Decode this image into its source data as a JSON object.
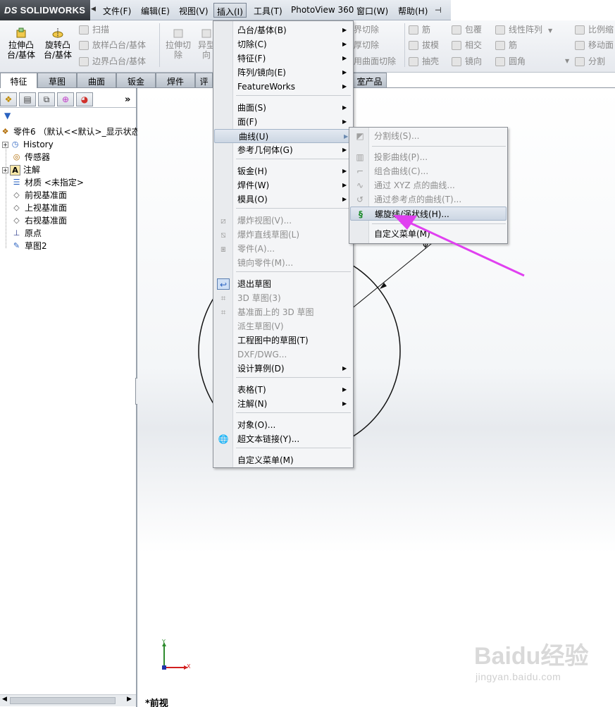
{
  "app": {
    "logo": "SOLIDWORKS",
    "logo_prefix": "DS"
  },
  "menubar": {
    "items": [
      "文件(F)",
      "编辑(E)",
      "视图(V)",
      "插入(I)",
      "工具(T)",
      "PhotoView 360",
      "窗口(W)",
      "帮助(H)"
    ],
    "active_index": 3
  },
  "ribbon": {
    "extrude_boss": "拉伸凸\n台/基体",
    "revolve_boss": "旋转凸\n台/基体",
    "sweep": "扫描",
    "loft": "放样凸台/基体",
    "boundary": "边界凸台/基体",
    "extrude_cut": "拉伸切\n除",
    "hole_wizard": "异型\n向",
    "boundary_cut": "界切除",
    "loft_cut": "厚切除",
    "surface_cut": "用曲面切除",
    "rib": "筋",
    "draft": "拔模",
    "shell": "抽壳",
    "wrap": "包覆",
    "intersect": "相交",
    "mirror": "镜向",
    "linear_pattern": "线性阵列",
    "rib2": "筋",
    "fillet": "圆角",
    "scale": "比例缩",
    "move_face": "移动面",
    "split": "分割"
  },
  "tabs": {
    "items": [
      "特征",
      "草图",
      "曲面",
      "钣金",
      "焊件",
      "评",
      "室产品"
    ],
    "selected_index": 0
  },
  "tree": {
    "root": "零件6 （默认<<默认>_显示状态",
    "items": [
      "History",
      "传感器",
      "注解",
      "材质 <未指定>",
      "前视基准面",
      "上视基准面",
      "右视基准面",
      "原点",
      "草图2"
    ]
  },
  "insert_menu": {
    "items": [
      {
        "label": "凸台/基体(B)",
        "sub": true
      },
      {
        "label": "切除(C)",
        "sub": true
      },
      {
        "label": "特征(F)",
        "sub": true
      },
      {
        "label": "阵列/镜向(E)",
        "sub": true
      },
      {
        "label": "FeatureWorks",
        "sub": true
      },
      {
        "label": "曲面(S)",
        "sub": true
      },
      {
        "label": "面(F)",
        "sub": true
      },
      {
        "label": "曲线(U)",
        "sub": true,
        "highlighted": true
      },
      {
        "label": "参考几何体(G)",
        "sub": true
      },
      {
        "label": "钣金(H)",
        "sub": true
      },
      {
        "label": "焊件(W)",
        "sub": true
      },
      {
        "label": "模具(O)",
        "sub": true
      },
      {
        "label": "爆炸视图(V)...",
        "disabled": true
      },
      {
        "label": "爆炸直线草图(L)",
        "disabled": true
      },
      {
        "label": "零件(A)...",
        "disabled": true
      },
      {
        "label": "镜向零件(M)...",
        "disabled": true
      },
      {
        "label": "退出草图"
      },
      {
        "label": "3D 草图(3)",
        "disabled": true
      },
      {
        "label": "基准面上的 3D 草图",
        "disabled": true
      },
      {
        "label": "派生草图(V)",
        "disabled": true
      },
      {
        "label": "工程图中的草图(T)"
      },
      {
        "label": "DXF/DWG...",
        "disabled": true
      },
      {
        "label": "设计算例(D)",
        "sub": true
      },
      {
        "label": "表格(T)",
        "sub": true
      },
      {
        "label": "注解(N)",
        "sub": true
      },
      {
        "label": "对象(O)..."
      },
      {
        "label": "超文本链接(Y)..."
      },
      {
        "label": "自定义菜单(M)"
      }
    ]
  },
  "curve_menu": {
    "items": [
      {
        "label": "分割线(S)...",
        "disabled": true
      },
      {
        "label": "投影曲线(P)...",
        "disabled": true
      },
      {
        "label": "组合曲线(C)...",
        "disabled": true
      },
      {
        "label": "通过 XYZ 点的曲线...",
        "disabled": true
      },
      {
        "label": "通过参考点的曲线(T)...",
        "disabled": true
      },
      {
        "label": "螺旋线/涡状线(H)...",
        "highlighted": true
      },
      {
        "label": "自定义菜单(M)"
      }
    ]
  },
  "canvas": {
    "view_name": "*前视",
    "dimension_symbol": "φ",
    "axis_x": "X",
    "axis_y": "Y",
    "watermark": "Baidu经验",
    "watermark_url": "jingyan.baidu.com"
  },
  "colors": {
    "annotation_arrow": "#e040f0",
    "accent_blue": "#2a62c0"
  }
}
